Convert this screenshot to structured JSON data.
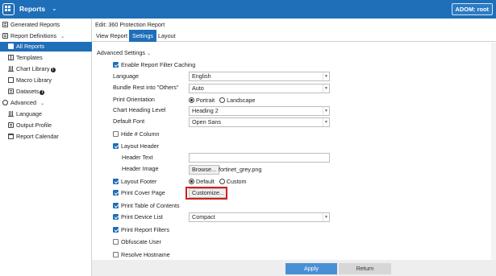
{
  "topbar": {
    "app_name": "Reports",
    "adom_label": "ADOM: root"
  },
  "sidebar": {
    "items": [
      {
        "label": "Generated Reports"
      },
      {
        "label": "Report Definitions"
      },
      {
        "label": "All Reports"
      },
      {
        "label": "Templates"
      },
      {
        "label": "Chart Library"
      },
      {
        "label": "Macro Library"
      },
      {
        "label": "Datasets"
      },
      {
        "label": "Advanced"
      },
      {
        "label": "Language"
      },
      {
        "label": "Output Profile"
      },
      {
        "label": "Report Calendar"
      }
    ]
  },
  "main": {
    "edit_title": "Edit: 360 Protection Report",
    "tabs": [
      {
        "label": "View Report"
      },
      {
        "label": "Settings"
      },
      {
        "label": "Layout"
      }
    ],
    "section_title": "Advanced Settings"
  },
  "settings": {
    "enable_filter_caching": {
      "label": "Enable Report Filter Caching",
      "checked": true
    },
    "language": {
      "label": "Language",
      "value": "English"
    },
    "bundle_rest": {
      "label": "Bundle Rest into \"Others\"",
      "value": "Auto"
    },
    "print_orientation": {
      "label": "Print Orientation",
      "options": [
        "Portrait",
        "Landscape"
      ],
      "selected": "Portrait"
    },
    "chart_heading_level": {
      "label": "Chart Heading Level",
      "value": "Heading 2"
    },
    "default_font": {
      "label": "Default Font",
      "value": "Open Sans"
    },
    "hide_column": {
      "label": "Hide # Column",
      "checked": false
    },
    "layout_header": {
      "label": "Layout Header",
      "checked": true
    },
    "header_text": {
      "label": "Header Text",
      "value": ""
    },
    "header_image": {
      "label": "Header Image",
      "browse_label": "Browse...",
      "file_name": "fortinet_grey.png"
    },
    "layout_footer": {
      "label": "Layout Footer",
      "checked": true,
      "options": [
        "Default",
        "Custom"
      ],
      "selected": "Default"
    },
    "print_cover_page": {
      "label": "Print Cover Page",
      "checked": true,
      "button_label": "Customize..."
    },
    "print_toc": {
      "label": "Print Table of Contents",
      "checked": true
    },
    "print_device_list": {
      "label": "Print Device List",
      "checked": true,
      "value": "Compact"
    },
    "print_report_filters": {
      "label": "Print Report Filters",
      "checked": true
    },
    "obfuscate_user": {
      "label": "Obfuscate User",
      "checked": false
    },
    "resolve_hostname": {
      "label": "Resolve Hostname",
      "checked": false
    }
  },
  "footer": {
    "apply_label": "Apply",
    "return_label": "Return"
  },
  "colors": {
    "brand": "#1f6eb8",
    "apply": "#4a8fd6",
    "highlight": "#d11f1f"
  },
  "icons": [
    "app-grid-icon",
    "document-icon",
    "chart-icon",
    "gear-icon",
    "info-icon",
    "calendar-icon",
    "chevron-down-icon"
  ]
}
